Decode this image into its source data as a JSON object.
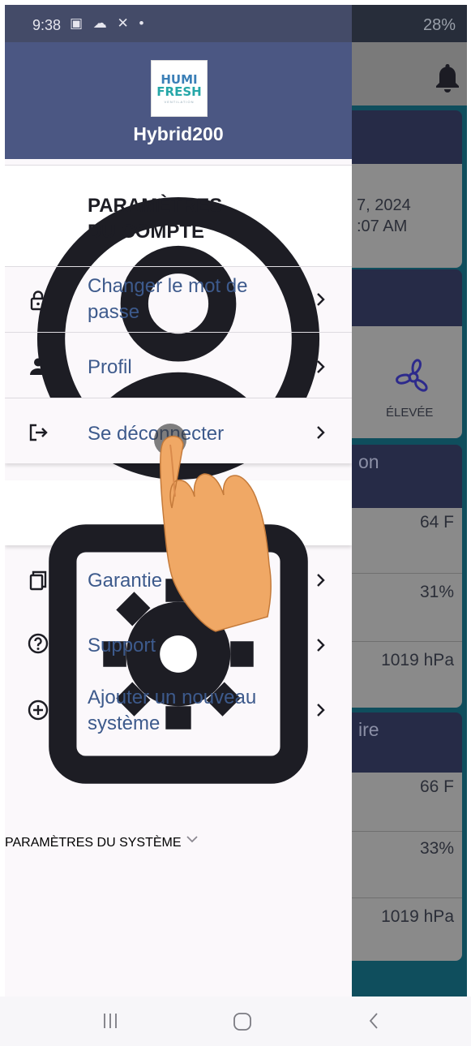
{
  "status_bar": {
    "time": "9:38",
    "notification_icons": "▣ ☁ ✕ •",
    "right_indicators": "28%"
  },
  "background_app": {
    "date_line1": "7, 2024",
    "date_line2": ":07 AM",
    "fan_label": "ÉLEVÉE",
    "section1_title": "on",
    "section1_temp": "64 F",
    "section1_humidity": "31%",
    "section1_pressure": "1019 hPa",
    "section2_title": "ire",
    "section2_temp": "66 F",
    "section2_humidity": "33%",
    "section2_pressure": "1019 hPa"
  },
  "drawer": {
    "logo_line1": "HUMI",
    "logo_line2": "FRESH",
    "logo_line3": "VENTILATION",
    "device_name": "Hybrid200",
    "account_section": {
      "line1": "PARAMÈTRES",
      "line2": "DU COMPTE",
      "icon": "account-circle-icon",
      "expanded": true
    },
    "account_items": [
      {
        "line1": "Changer le mot de",
        "line2": "passe",
        "icon": "lock-icon"
      },
      {
        "line1": "Profil",
        "icon": "person-icon"
      },
      {
        "line1": "Se déconnecter",
        "icon": "logout-icon"
      }
    ],
    "system_section": {
      "line1": "PARAMÈTRES",
      "line2": "DU SYSTÈME",
      "icon": "settings-icon",
      "expanded": false
    },
    "other_items": [
      {
        "line1": "Garantie",
        "icon": "copy-icon"
      },
      {
        "line1": "Support",
        "icon": "help-icon"
      },
      {
        "line1": "Ajouter un nouveau",
        "line2": "système",
        "icon": "add-circle-icon"
      }
    ]
  },
  "colors": {
    "header": "#4b5783",
    "link_text": "#3d5a8c",
    "section_text": "#1d1d24",
    "drawer_bg": "#fbf8fb",
    "touch_hand": "#f0a865"
  }
}
